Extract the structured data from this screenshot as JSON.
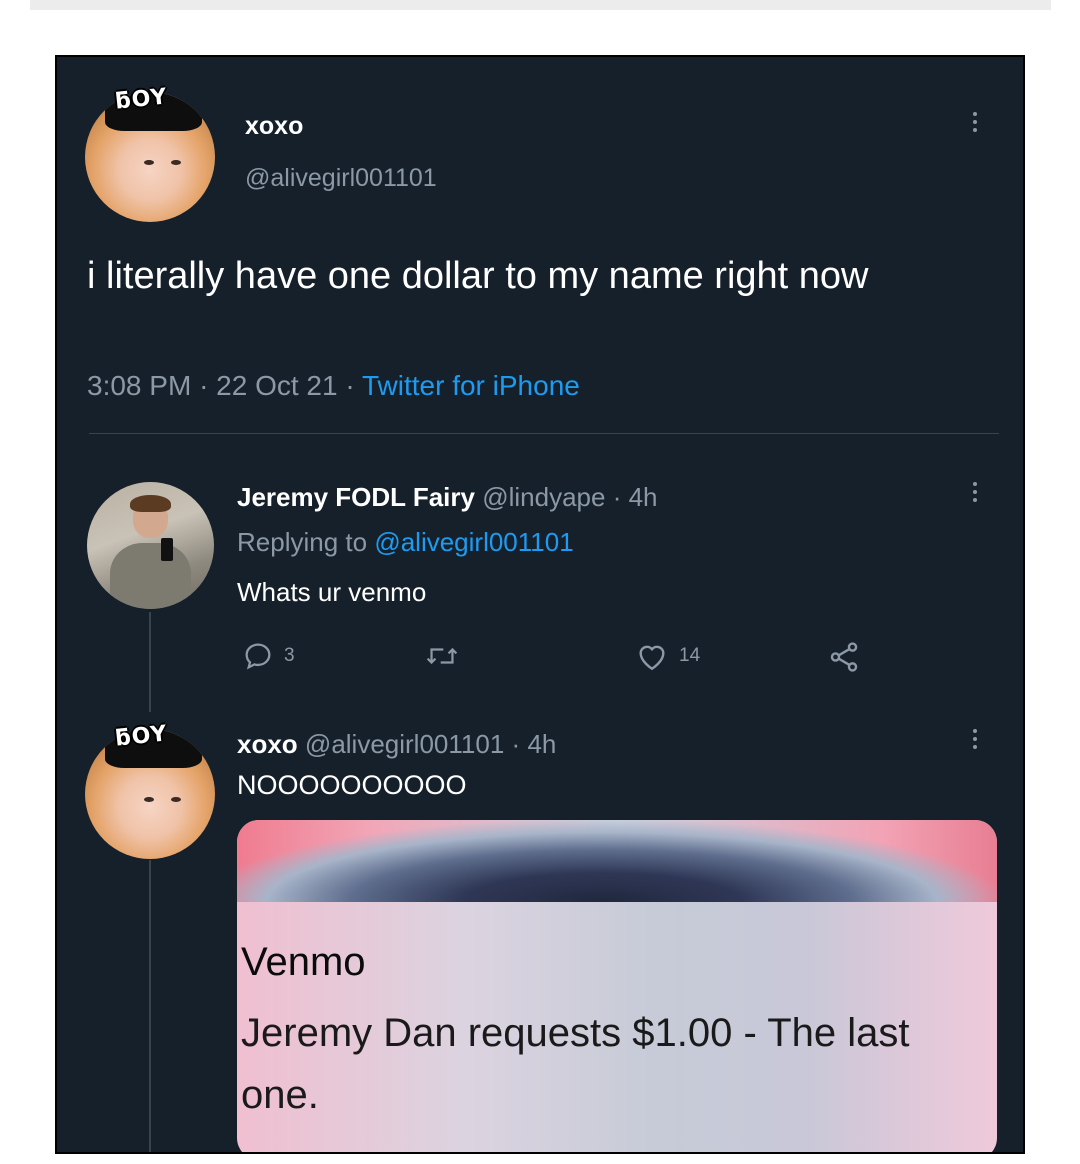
{
  "tweet": {
    "display_name": "xoxo",
    "handle": "@alivegirl001101",
    "text": "i literally have one dollar to my name right now",
    "time": "3:08 PM",
    "date": "22 Oct 21",
    "source": "Twitter for iPhone",
    "avatar_badge": "ƃOY"
  },
  "reply1": {
    "display_name": "Jeremy FODL Fairy",
    "handle": "@lindyape",
    "age": "4h",
    "replying_prefix": "Replying to",
    "replying_to": "@alivegirl001101",
    "text": "Whats ur venmo",
    "reply_count": "3",
    "like_count": "14"
  },
  "reply2": {
    "display_name": "xoxo",
    "handle": "@alivegirl001101",
    "age": "4h",
    "text": "NOOOOOOOOOO",
    "avatar_badge": "ƃOY",
    "card": {
      "title": "Venmo",
      "body": "Jeremy Dan requests $1.00 - The last one."
    }
  },
  "separator": "·",
  "icons": [
    "more-icon",
    "reply-icon",
    "retweet-icon",
    "like-icon",
    "share-icon"
  ]
}
